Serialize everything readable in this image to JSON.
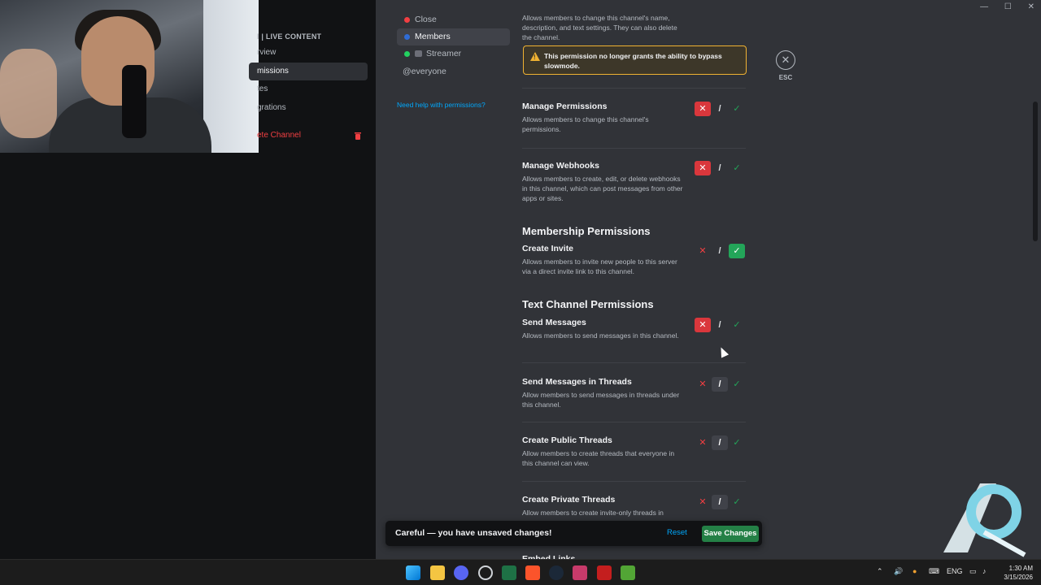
{
  "window_controls": [
    "—",
    "☐",
    "✕"
  ],
  "sidebar": {
    "header": "I | LIVE CONTENT",
    "items": [
      {
        "label": "rview"
      },
      {
        "label": "missions"
      },
      {
        "label": "tes"
      },
      {
        "label": "grations"
      },
      {
        "label": "ete Channel"
      }
    ]
  },
  "roles": {
    "items": [
      {
        "label": "Close",
        "color": "#f23f42"
      },
      {
        "label": "Members",
        "color": "#2f6cd6"
      },
      {
        "label": "Streamer",
        "color": "#23d160"
      },
      {
        "label": "@everyone"
      }
    ],
    "help_link": "Need help with permissions?"
  },
  "main": {
    "top_cut_desc": "Allows members to change this channel's name, description, and text settings. They can also delete the channel.",
    "warning": "This permission no longer grants the ability to bypass slowmode.",
    "esc_label": "ESC",
    "sections": {
      "membership": "Membership Permissions",
      "text_channel": "Text Channel Permissions"
    },
    "permissions": [
      {
        "title": "Manage Permissions",
        "desc": "Allows members to change this channel's permissions.",
        "state": "deny"
      },
      {
        "title": "Manage Webhooks",
        "desc": "Allows members to create, edit, or delete webhooks in this channel, which can post messages from other apps or sites.",
        "state": "deny"
      },
      {
        "title": "Create Invite",
        "desc": "Allows members to invite new people to this server via a direct invite link to this channel.",
        "state": "allow"
      },
      {
        "title": "Send Messages",
        "desc": "Allows members to send messages in this channel.",
        "state": "deny"
      },
      {
        "title": "Send Messages in Threads",
        "desc": "Allow members to send messages in threads under this channel.",
        "state": "neutral"
      },
      {
        "title": "Create Public Threads",
        "desc": "Allow members to create threads that everyone in this channel can view.",
        "state": "neutral"
      },
      {
        "title": "Create Private Threads",
        "desc": "Allow members to create invite-only threads in",
        "state": "neutral"
      },
      {
        "title": "Embed Links",
        "desc": "",
        "state": "neutral"
      }
    ],
    "toggle_glyphs": {
      "deny": "✕",
      "neutral": "/",
      "allow": "✓"
    }
  },
  "unsaved_bar": {
    "message": "Careful — you have unsaved changes!",
    "reset_label": "Reset",
    "save_label": "Save Changes"
  },
  "taskbar": {
    "tray": {
      "lang": "ENG"
    },
    "clock": {
      "time": "1:30 AM",
      "date": "3/15/2026"
    }
  }
}
